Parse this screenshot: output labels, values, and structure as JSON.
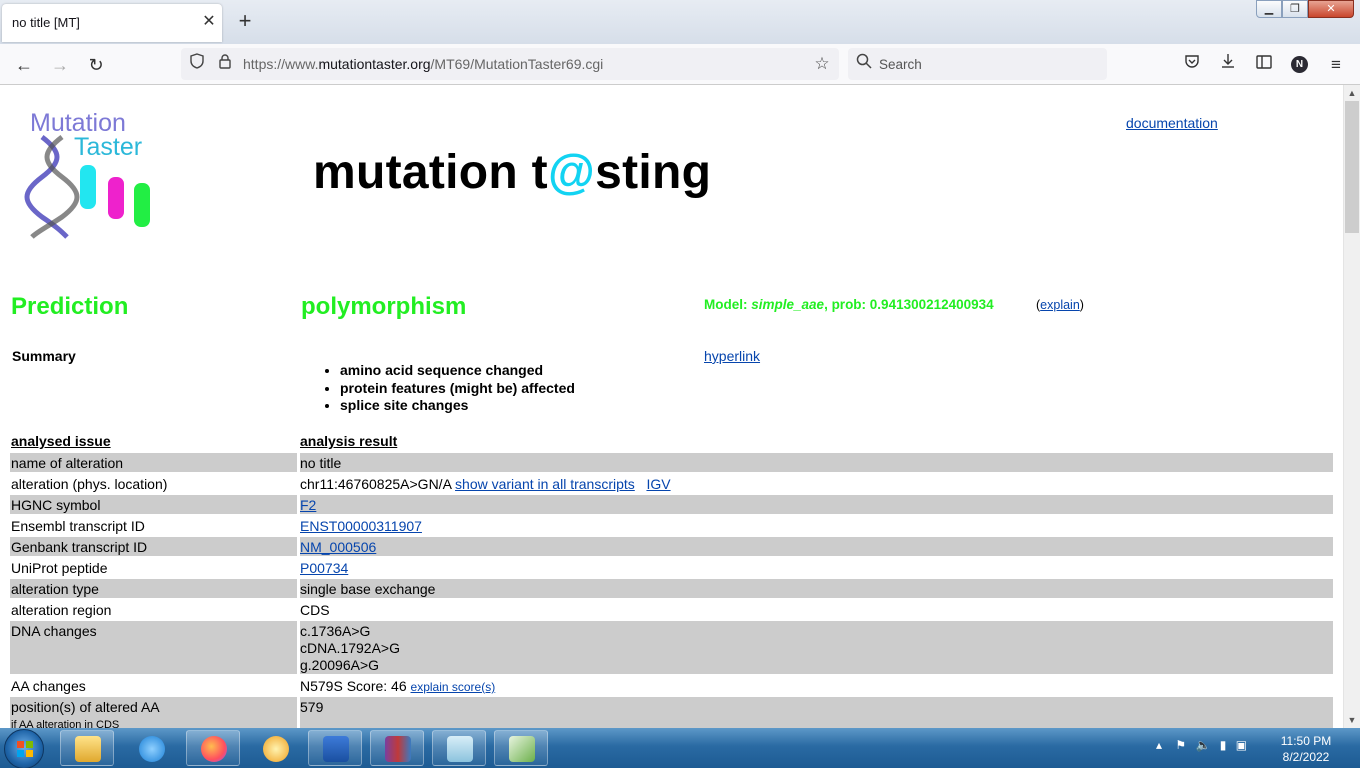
{
  "browser": {
    "tab_title": "no title [MT]",
    "url_prefix": "https://www.",
    "url_host": "mutationtaster.org",
    "url_path": "/MT69/MutationTaster69.cgi",
    "search_placeholder": "Search",
    "profile_initial": "N"
  },
  "page": {
    "logo_line1": "Mutation",
    "logo_line2": "Taster",
    "headline_pre": "mutation t",
    "headline_at": "@",
    "headline_post": "sting",
    "documentation_link": "documentation",
    "prediction_label": "Prediction",
    "prediction_value": "polymorphism",
    "model_label": "Model: ",
    "model_name": "simple_aae",
    "model_prob": ", prob: 0.941300212400934",
    "explain_open": "(",
    "explain_link": "explain",
    "explain_close": ")",
    "summary_label": "Summary",
    "summary_items": [
      "amino acid sequence changed",
      "protein features (might be) affected",
      "splice site changes"
    ],
    "hyperlink": "hyperlink",
    "col_issue": "analysed issue",
    "col_result": "analysis result",
    "rows": {
      "name": {
        "label": "name of alteration",
        "value": "no title"
      },
      "alteration": {
        "label": "alteration (phys. location)",
        "value": "chr11:46760825A>GN/A",
        "link1": "show variant in all transcripts",
        "link2": "IGV"
      },
      "hgnc": {
        "label": "HGNC symbol",
        "value": "F2"
      },
      "ensembl": {
        "label": "Ensembl transcript ID",
        "value": "ENST00000311907"
      },
      "genbank": {
        "label": "Genbank transcript ID",
        "value": "NM_000506"
      },
      "uniprot": {
        "label": "UniProt peptide",
        "value": "P00734"
      },
      "alt_type": {
        "label": "alteration type",
        "value": "single base exchange"
      },
      "alt_region": {
        "label": "alteration region",
        "value": "CDS"
      },
      "dna": {
        "label": "DNA changes",
        "line1": "c.1736A>G",
        "line2": "cDNA.1792A>G",
        "line3": "g.20096A>G"
      },
      "aa": {
        "label": "AA changes",
        "value": "N579S Score: 46",
        "link": "explain score(s)"
      },
      "position": {
        "label": "position(s) of altered AA",
        "sublabel": "if AA alteration in CDS",
        "value": "579"
      }
    }
  },
  "taskbar": {
    "time": "11:50 PM",
    "date": "8/2/2022"
  },
  "colors": {
    "prediction_green": "#22ee22",
    "headline_at": "#12d3f2",
    "row_grey": "#cccccc",
    "link": "#0645ad"
  }
}
